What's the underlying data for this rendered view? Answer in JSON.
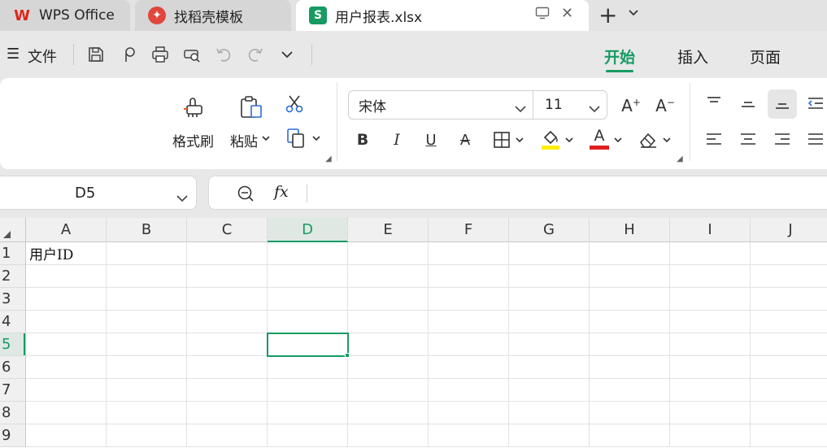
{
  "tabs": {
    "app": "WPS Office",
    "templates": "找稻壳模板",
    "document": "用户报表.xlsx",
    "sheet_icon": "S"
  },
  "menu": {
    "file": "文件",
    "ribbon_tabs": [
      "开始",
      "插入",
      "页面"
    ]
  },
  "ribbon": {
    "format_painter": "格式刷",
    "paste": "粘贴",
    "font_name": "宋体",
    "font_size": "11",
    "bold": "B",
    "italic": "I",
    "underline": "U",
    "strike": "A",
    "font_color_letter": "A",
    "increase_font": "A",
    "decrease_font": "A"
  },
  "formula_bar": {
    "name_box": "D5",
    "fx_label": "fx",
    "content": ""
  },
  "grid": {
    "columns": [
      "A",
      "B",
      "C",
      "D",
      "E",
      "F",
      "G",
      "H",
      "I",
      "J"
    ],
    "rows": [
      "1",
      "2",
      "3",
      "4",
      "5",
      "6",
      "7",
      "8",
      "9"
    ],
    "selected_column": "D",
    "selected_row": "5",
    "cells": {
      "A1": "用户ID"
    }
  },
  "colors": {
    "accent": "#169b62",
    "fill_color": "#ffee00",
    "font_color": "#e02020",
    "wps_red": "#e1251b"
  }
}
